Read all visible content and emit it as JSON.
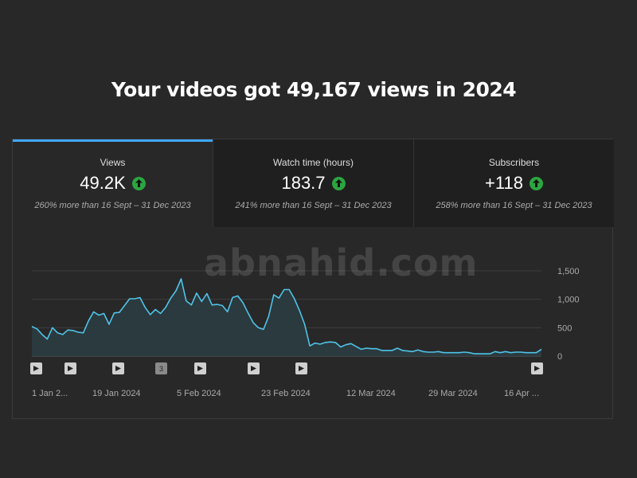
{
  "headline": "Your videos got 49,167 views in 2024",
  "tabs": [
    {
      "label": "Views",
      "value": "49.2K",
      "compare": "260% more than 16 Sept – 31 Dec 2023",
      "active": true
    },
    {
      "label": "Watch time (hours)",
      "value": "183.7",
      "compare": "241% more than 16 Sept – 31 Dec 2023",
      "active": false
    },
    {
      "label": "Subscribers",
      "value": "+118",
      "compare": "258% more than 16 Sept – 31 Dec 2023",
      "active": false
    }
  ],
  "watermark": "abnahid.com",
  "colors": {
    "accent": "#3ea6ff",
    "up": "#2ba640",
    "line": "#4fc3e8"
  },
  "chart_data": {
    "type": "area",
    "x_tick_labels": [
      "1 Jan 2...",
      "19 Jan 2024",
      "5 Feb 2024",
      "23 Feb 2024",
      "12 Mar 2024",
      "29 Mar 2024",
      "16 Apr ..."
    ],
    "y_tick_labels": [
      "1,500",
      "1,000",
      "500",
      "0"
    ],
    "ylim": [
      0,
      1500
    ],
    "grid": true,
    "values": [
      520,
      480,
      380,
      300,
      500,
      410,
      380,
      460,
      450,
      420,
      410,
      620,
      780,
      720,
      750,
      560,
      760,
      770,
      890,
      1010,
      1010,
      1030,
      860,
      730,
      820,
      750,
      860,
      1020,
      1150,
      1360,
      970,
      900,
      1110,
      960,
      1100,
      900,
      910,
      890,
      780,
      1030,
      1060,
      940,
      760,
      590,
      500,
      470,
      700,
      1080,
      1020,
      1170,
      1170,
      1010,
      800,
      560,
      180,
      230,
      210,
      240,
      250,
      240,
      160,
      200,
      220,
      170,
      120,
      140,
      130,
      130,
      100,
      100,
      100,
      140,
      100,
      90,
      80,
      110,
      80,
      70,
      70,
      80,
      60,
      60,
      60,
      60,
      70,
      60,
      40,
      40,
      40,
      40,
      80,
      60,
      80,
      60,
      70,
      70,
      60,
      60,
      60,
      120
    ],
    "markers": [
      "play",
      "play",
      "play",
      "3",
      "play",
      "play",
      "play",
      "play"
    ]
  }
}
